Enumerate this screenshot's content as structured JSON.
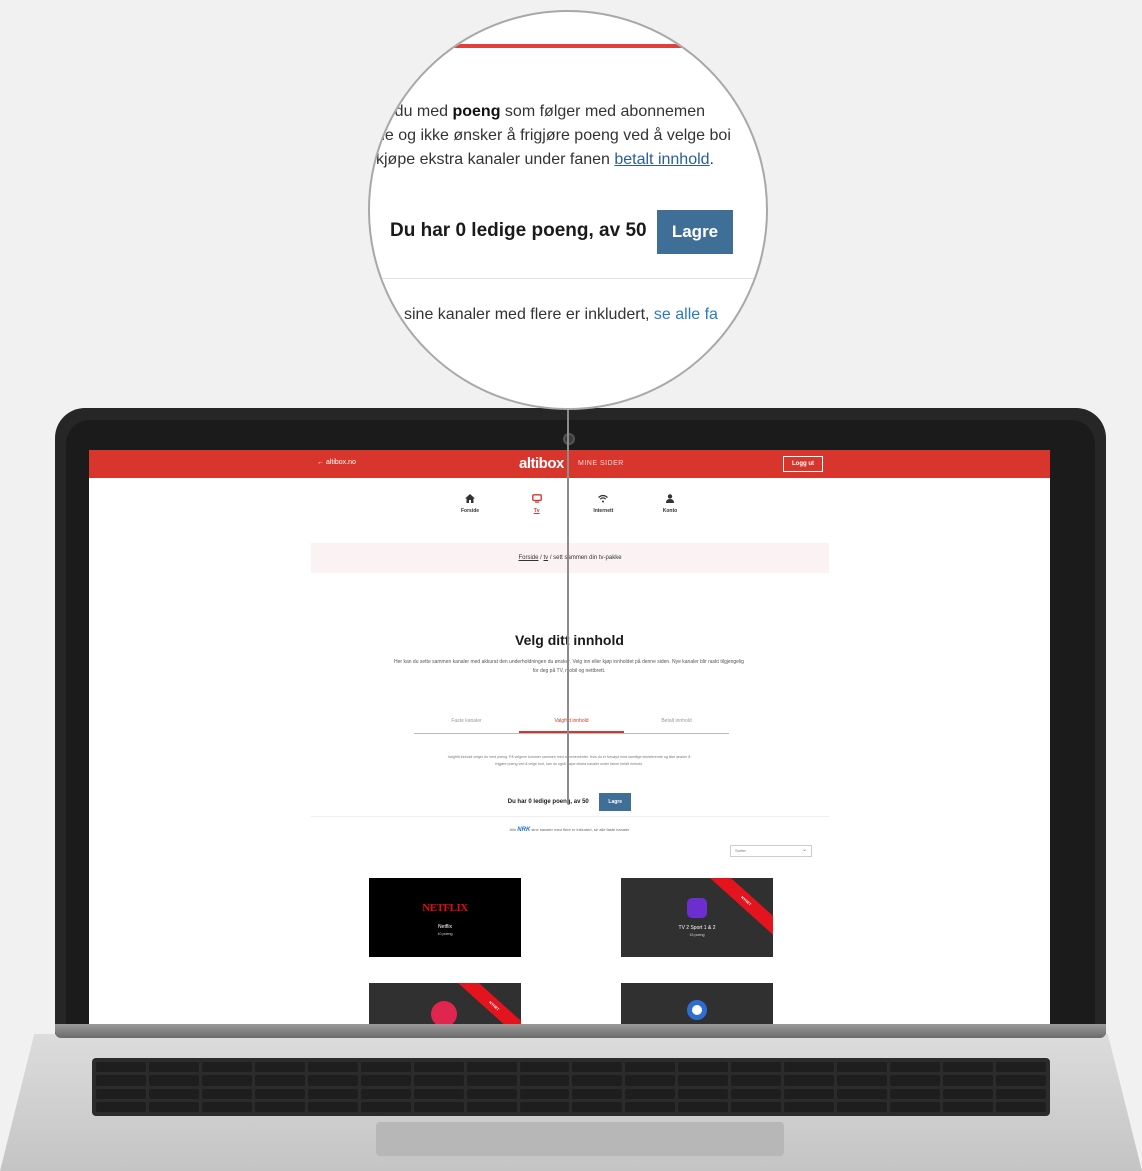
{
  "magnifier": {
    "line1_pre": "er du med ",
    "line1_bold": "poeng",
    "line1_post": " som følger med abonnemen",
    "line2": "ne og ikke ønsker å frigjøre poeng ved å velge boi",
    "line3_pre": "kjøpe ekstra kanaler under fanen ",
    "line3_link": "betalt innhold",
    "line3_post": ".",
    "points_text": "Du har 0 ledige poeng, av 50",
    "save_label": "Lagre",
    "channels_pre": "sine kanaler med flere er inkludert, ",
    "channels_link": "se alle fa"
  },
  "header": {
    "back_label": "← altibox.no",
    "brand": "altibox",
    "brand_sub": "MINE SIDER",
    "logout_label": "Logg ut"
  },
  "nav": {
    "items": [
      {
        "label": "Forside",
        "icon": "home-icon"
      },
      {
        "label": "Tv",
        "icon": "tv-icon"
      },
      {
        "label": "Internett",
        "icon": "wifi-icon"
      },
      {
        "label": "Konto",
        "icon": "user-icon"
      }
    ]
  },
  "breadcrumb": {
    "home": "Forside",
    "sep1": " / ",
    "tv": "tv",
    "sep2": " / ",
    "current": "sett sammen din tv-pakke"
  },
  "main": {
    "title": "Velg ditt innhold",
    "intro": "Her kan du sette sammen kanaler med akkurat den underholdningen du ønsker. Velg inn eller kjøp innholdet på denne siden. Nye kanaler blir raskt tilgjengelig for deg på TV, mobil og nettbrett.",
    "tabs": [
      "Faste kanaler",
      "Valgfritt innhold",
      "Betalt innhold"
    ],
    "info": "Valgfritt innhold velger du med poeng. På velgene kommer sammen med abonnementet. Hvis du er fornøyd med samtlige eksisterende og ikke ønsker å frigjøre poeng ved å velge bort, kan du også kjøpe ekstra kanaler under fanen betalt innhold.",
    "points_text": "Du har 0 ledige poeng, av 50",
    "save_label": "Lagre",
    "channels_pre": "Alle ",
    "channels_brand": "NRK",
    "channels_post": " sine kanaler med flere er inkludert, se alle faste kanaler",
    "sort_label": "Sorter"
  },
  "cards": [
    {
      "logo": "NETFLIX",
      "name": "Netflix",
      "points": "10 poeng",
      "ribbon": ""
    },
    {
      "logo": "",
      "name": "TV 2 Sport 1 & 2",
      "points": "15 poeng",
      "ribbon": "NYHET"
    },
    {
      "logo": "",
      "name": "",
      "points": "",
      "ribbon": "NYHET"
    },
    {
      "logo": "",
      "name": "",
      "points": "",
      "ribbon": ""
    }
  ],
  "colors": {
    "brand_red": "#d8362c",
    "button_blue": "#3f6f96",
    "link_blue": "#2a5d9a"
  }
}
